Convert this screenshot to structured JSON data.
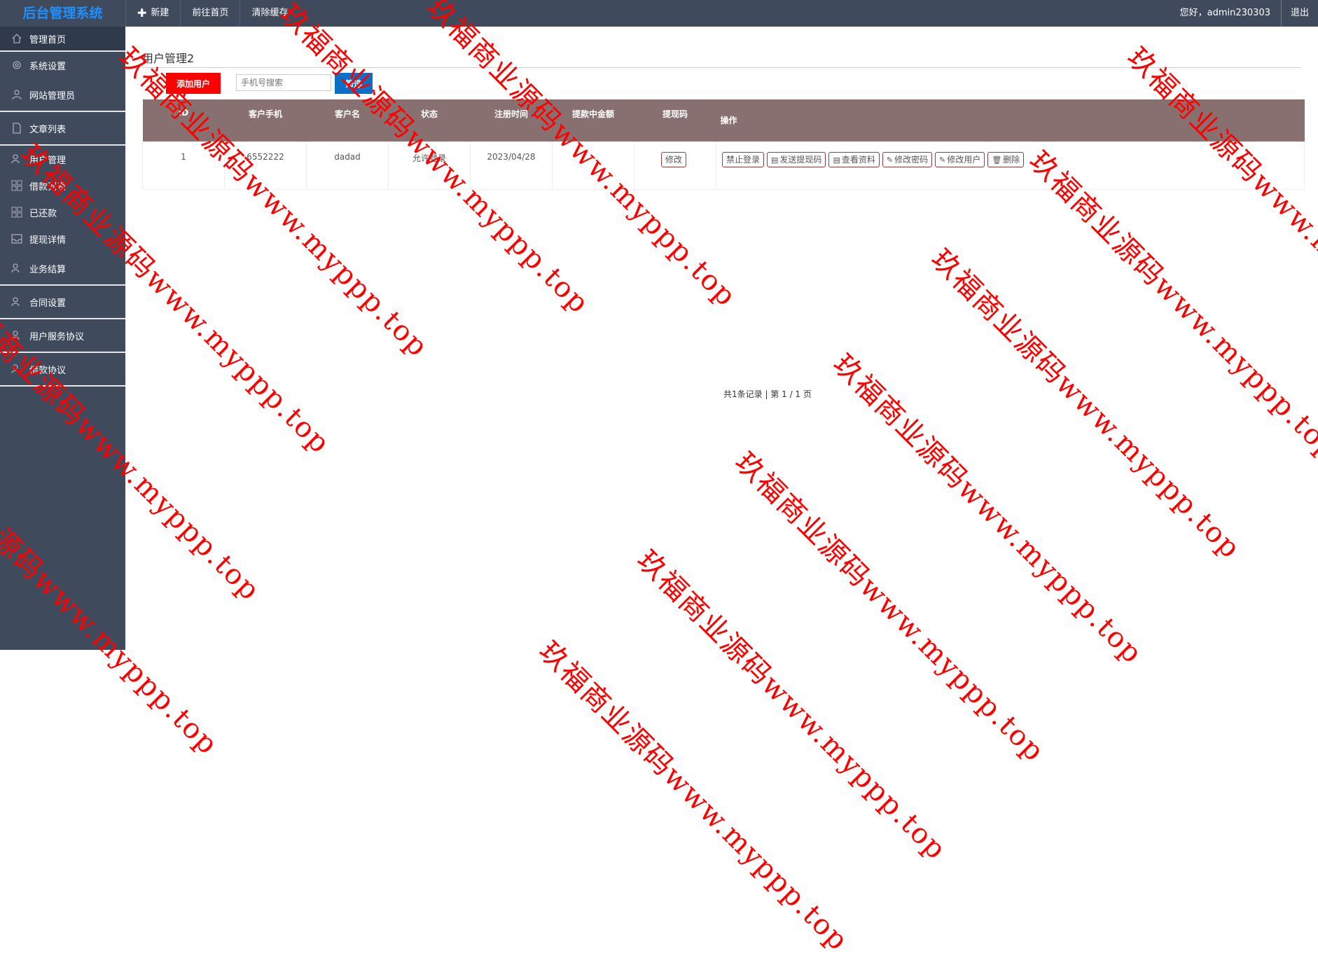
{
  "topbar": {
    "brand": "后台管理系统",
    "nav": [
      {
        "label": "新建",
        "icon": "plus-icon"
      },
      {
        "label": "前往首页"
      },
      {
        "label": "清除缓存"
      }
    ],
    "greeting": "您好，admin230303",
    "logout": "退出"
  },
  "sidebar": {
    "items": [
      {
        "label": "管理首页",
        "icon": "home-icon"
      },
      {
        "label": "系统设置",
        "icon": "gear-icon"
      },
      {
        "label": "网站管理员",
        "icon": "user-icon"
      },
      {
        "label": "文章列表",
        "icon": "document-icon"
      },
      {
        "label": "用户管理",
        "icon": "users-icon"
      },
      {
        "label": "借款列表",
        "icon": "grid-icon"
      },
      {
        "label": "已还款",
        "icon": "grid-icon"
      },
      {
        "label": "提现详情",
        "icon": "inbox-icon"
      },
      {
        "label": "业务结算",
        "icon": "users-icon"
      },
      {
        "label": "合同设置",
        "icon": "users-icon"
      },
      {
        "label": "用户服务协议",
        "icon": "users-icon"
      },
      {
        "label": "借款协议",
        "icon": "users-icon"
      }
    ]
  },
  "main": {
    "title": "用户管理2",
    "add_button": "添加用户",
    "search_placeholder": "手机号搜索",
    "filter_button": "筛选",
    "table": {
      "headers": [
        "ID",
        "客户手机",
        "客户名",
        "状态",
        "注册时间",
        "提款中金额",
        "提现码",
        "操作"
      ],
      "rows": [
        {
          "id": "1",
          "phone": "6552222",
          "name": "dadad",
          "status": "允许登录",
          "registered": "2023/04/28",
          "amount": "",
          "code_button": "修改",
          "actions": [
            "禁止登录",
            "发送提现码",
            "查看资料",
            "修改密码",
            "修改用户",
            "删除"
          ]
        }
      ]
    },
    "pager": "共1条记录 | 第 1 / 1 页"
  },
  "watermark": "玖福商业源码www.myppp.top",
  "colors": {
    "topbar": "#3f4a5c",
    "brand": "#1e90ff",
    "table_header": "#87706f",
    "add_button": "#ff0000",
    "filter_button": "#0a6fc7"
  }
}
